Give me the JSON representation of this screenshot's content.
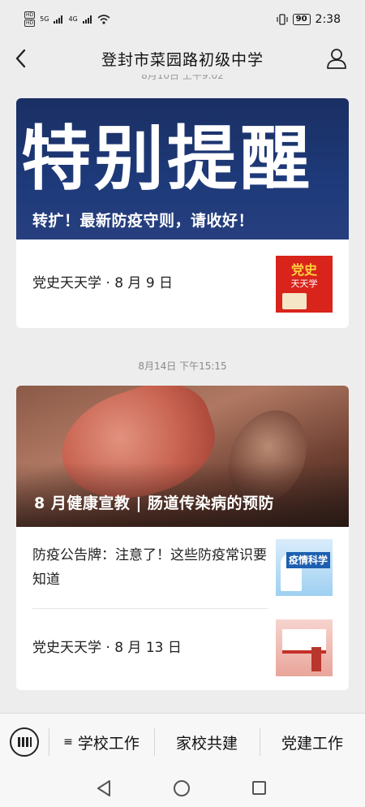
{
  "status_bar": {
    "left_labels": [
      "HD",
      "5G",
      "4G"
    ],
    "battery": "90",
    "time": "2:38"
  },
  "header": {
    "title": "登封市菜园路初级中学"
  },
  "feed": {
    "cut_timestamp": "8月10日 上午9:02",
    "article1": {
      "hero_big": "特别提醒",
      "hero_caption": "转扩！最新防疫守则，请收好！",
      "sub_title": "党史天天学 · 8 月 9 日",
      "sub_thumb_top": "党史",
      "sub_thumb_mid": "天天学"
    },
    "timestamp2": "8月14日 下午15:15",
    "article2": {
      "hero_caption": "8 月健康宣教 | 肠道传染病的预防",
      "sub1_title": "防疫公告牌：注意了！这些防疫常识要知道",
      "sub1_thumb_text": "疫情科学",
      "sub2_title": "党史天天学 · 8 月 13 日"
    }
  },
  "menu": {
    "items": [
      {
        "label": "学校工作",
        "icon": "menu-lines-icon"
      },
      {
        "label": "家校共建"
      },
      {
        "label": "党建工作"
      }
    ]
  },
  "colors": {
    "background": "#ededed",
    "hero_blue": "#1e3a7a",
    "thumb_red": "#d9241b"
  }
}
